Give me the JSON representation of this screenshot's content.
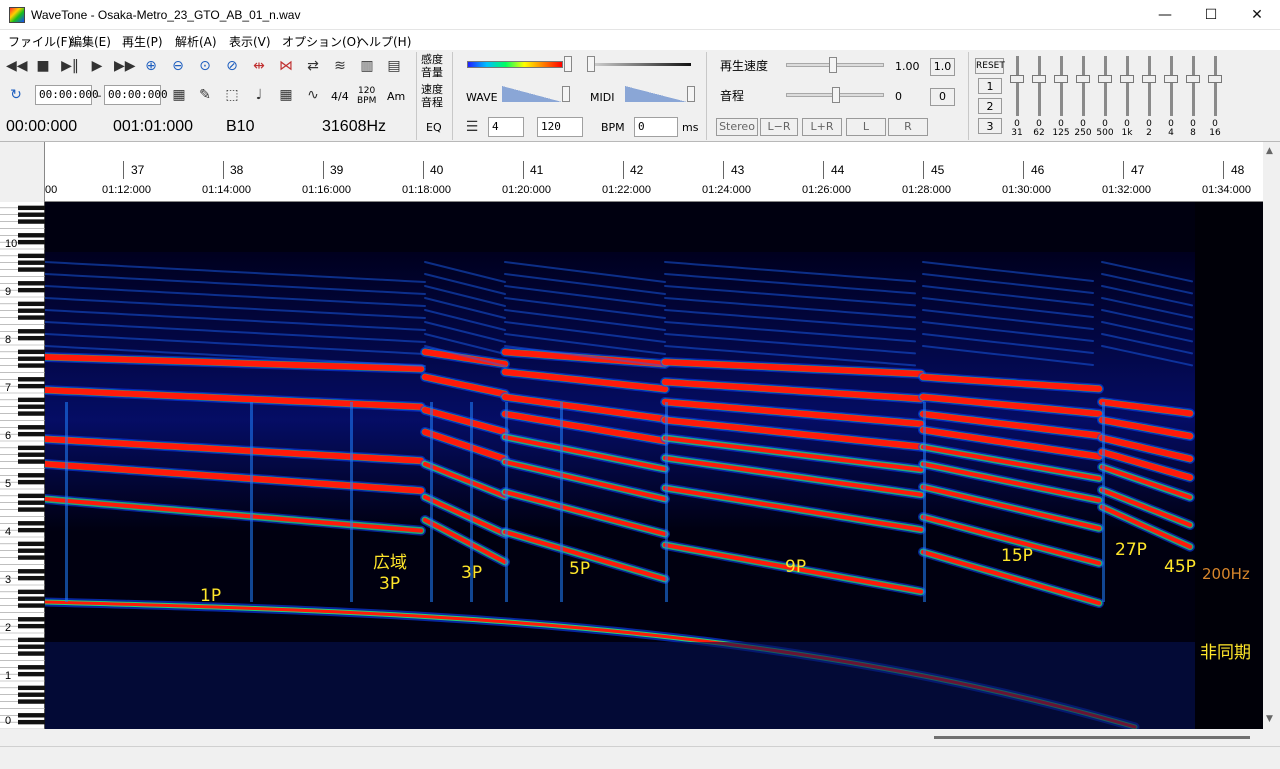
{
  "window": {
    "title": "WaveTone - Osaka-Metro_23_GTO_AB_01_n.wav",
    "minimize_glyph": "—",
    "maximize_glyph": "☐",
    "close_glyph": "✕"
  },
  "menu": [
    "ファイル(F)",
    "編集(E)",
    "再生(P)",
    "解析(A)",
    "表示(V)",
    "オプション(O)",
    "ヘルプ(H)"
  ],
  "transport": {
    "range_start": "00:00:000",
    "range_dash": "–",
    "range_end": "00:00:000",
    "icons": [
      "rewind-icon",
      "stop-icon",
      "play-pause-icon",
      "play-icon",
      "fast-forward-icon",
      "zoom-in-icon",
      "zoom-out-icon",
      "zoom-fit-icon",
      "zoom-reset-icon",
      "expand-icon",
      "contract-icon",
      "swap-icon",
      "wave-icon",
      "spectrum-icon",
      "notes-icon"
    ],
    "loop_icon": "loop-icon",
    "tool_labels": {
      "time_sig": "4/4",
      "bpm_top": "120",
      "bpm_bottom": "BPM",
      "am": "Am"
    }
  },
  "readout": {
    "position": "00:00:000",
    "measure": "001:01:000",
    "note": "B10",
    "frequency": "31608Hz"
  },
  "levels": {
    "sensitivity_label": "感度",
    "volume_label": "音量",
    "speed_label": "速度",
    "pitch_label": "音程",
    "eq_label": "EQ",
    "wave_label": "WAVE",
    "midi_label": "MIDI",
    "beat_value": "4",
    "bpm_value": "120",
    "bpm_label": "BPM",
    "offset_value": "0",
    "ms_label": "ms"
  },
  "playback": {
    "speed_label": "再生速度",
    "speed_value": "1.00",
    "speed_reset": "1.0",
    "pitch_label": "音程",
    "pitch_value": "0",
    "pitch_reset": "0",
    "stereo_label": "Stereo",
    "channel_buttons": [
      "L−R",
      "L+R",
      "L",
      "R"
    ]
  },
  "equalizer": {
    "reset_label": "RESET",
    "preset_buttons": [
      "1",
      "2",
      "3"
    ],
    "bands": [
      {
        "freq": "31",
        "value": "0"
      },
      {
        "freq": "62",
        "value": "0"
      },
      {
        "freq": "125",
        "value": "0"
      },
      {
        "freq": "250",
        "value": "0"
      },
      {
        "freq": "500",
        "value": "0"
      },
      {
        "freq": "1k",
        "value": "0"
      },
      {
        "freq": "2",
        "value": "0"
      },
      {
        "freq": "4",
        "value": "0"
      },
      {
        "freq": "8",
        "value": "0"
      },
      {
        "freq": "16",
        "value": "0"
      }
    ]
  },
  "ruler": {
    "bars": [
      "37",
      "38",
      "39",
      "40",
      "41",
      "42",
      "43",
      "44",
      "45",
      "46",
      "47",
      "48"
    ],
    "times": [
      "00",
      "01:12:000",
      "01:14:000",
      "01:16:000",
      "01:18:000",
      "01:20:000",
      "01:22:000",
      "01:24:000",
      "01:26:000",
      "01:28:000",
      "01:30:000",
      "01:32:000",
      "01:34:000"
    ]
  },
  "piano": {
    "octaves": [
      "10",
      "9",
      "8",
      "7",
      "6",
      "5",
      "4",
      "3",
      "2",
      "1",
      "0"
    ]
  },
  "annotations": [
    {
      "id": "1p",
      "text": "1P"
    },
    {
      "id": "wide3p_a",
      "text": "広域"
    },
    {
      "id": "wide3p_b",
      "text": "3P"
    },
    {
      "id": "3p",
      "text": "3P"
    },
    {
      "id": "5p",
      "text": "5P"
    },
    {
      "id": "9p",
      "text": "9P"
    },
    {
      "id": "15p",
      "text": "15P"
    },
    {
      "id": "27p",
      "text": "27P"
    },
    {
      "id": "45p",
      "text": "45P"
    },
    {
      "id": "200hz",
      "text": "200Hz"
    },
    {
      "id": "async",
      "text": "非同期"
    }
  ],
  "colors": {
    "annotation": "#ffe62a",
    "annotation_freq": "#d8862b",
    "spectrogram_bg": "#000010",
    "band_hot": "#ff1a0a",
    "band_mid": "#33ff66",
    "band_cool": "#0a40ff"
  }
}
